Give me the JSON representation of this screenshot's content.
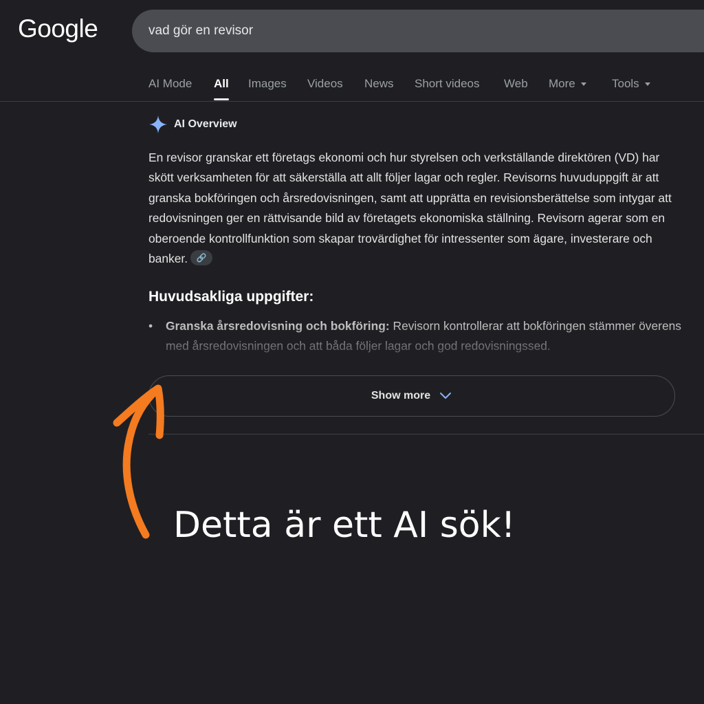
{
  "header": {
    "logo": "Google",
    "search_value": "vad gör en revisor"
  },
  "tabs": [
    {
      "label": "AI Mode"
    },
    {
      "label": "All",
      "active": true
    },
    {
      "label": "Images"
    },
    {
      "label": "Videos"
    },
    {
      "label": "News"
    },
    {
      "label": "Short videos"
    },
    {
      "label": "Web"
    },
    {
      "label": "More"
    },
    {
      "label": "Tools"
    }
  ],
  "ai_overview": {
    "label": "AI Overview",
    "text": "En revisor granskar ett företags ekonomi och hur styrelsen och verkställande direktören (VD) har skött verksamheten för att säkerställa att allt följer lagar och regler. Revisorns huvuduppgift är att granska bokföringen och årsredovisningen, samt att upprätta en revisionsberättelse som intygar att redovisningen ger en rättvisande bild av företagets ekonomiska ställning. Revisorn agerar som en oberoende kontrollfunktion som skapar trovärdighet för intressenter som ägare, investerare och banker.",
    "section_title": "Huvudsakliga uppgifter:",
    "bullet_title": "Granska årsredovisning och bokföring:",
    "bullet_text": " Revisorn kontrollerar att bokföringen stämmer överens med årsredovisningen och att båda följer lagar och god redovisningssed.",
    "show_more": "Show more"
  },
  "annotation": {
    "text": "Detta är ett AI sök!",
    "arrow_color": "#f47b20"
  },
  "colors": {
    "background": "#1f1f23",
    "search_bg": "#4a4c52",
    "sparkle": "#8ab4f8"
  }
}
